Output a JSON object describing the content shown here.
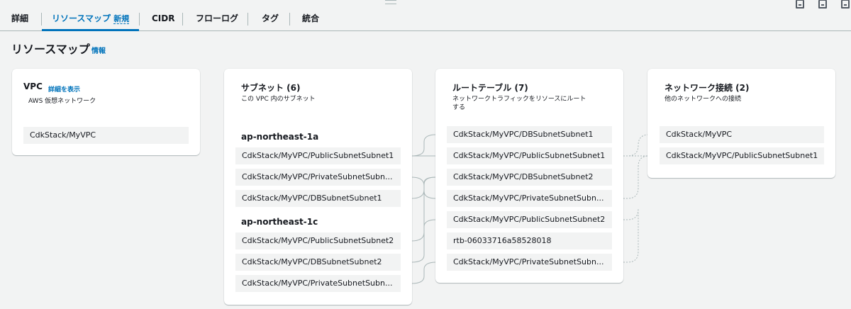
{
  "tabs": [
    {
      "label": "詳細"
    },
    {
      "label": "リソースマップ",
      "badge": "新規"
    },
    {
      "label": "CIDR"
    },
    {
      "label": "フローログ"
    },
    {
      "label": "タグ"
    },
    {
      "label": "統合"
    }
  ],
  "page": {
    "title": "リソースマップ",
    "info_link": "情報"
  },
  "vpc_card": {
    "title": "VPC",
    "detail_link": "詳細を表示",
    "description": "AWS 仮想ネットワーク",
    "items": [
      "CdkStack/MyVPC"
    ]
  },
  "subnets_card": {
    "title": "サブネット (6)",
    "description": "この VPC 内のサブネット",
    "groups": [
      {
        "az": "ap-northeast-1a",
        "items": [
          "CdkStack/MyVPC/PublicSubnetSubnet1",
          "CdkStack/MyVPC/PrivateSubnetSubn...",
          "CdkStack/MyVPC/DBSubnetSubnet1"
        ]
      },
      {
        "az": "ap-northeast-1c",
        "items": [
          "CdkStack/MyVPC/PublicSubnetSubnet2",
          "CdkStack/MyVPC/DBSubnetSubnet2",
          "CdkStack/MyVPC/PrivateSubnetSubn..."
        ]
      }
    ]
  },
  "route_tables_card": {
    "title": "ルートテーブル (7)",
    "description_line1": "ネットワークトラフィックをリソースにルート",
    "description_line2": "する",
    "items": [
      "CdkStack/MyVPC/DBSubnetSubnet1",
      "CdkStack/MyVPC/PublicSubnetSubnet1",
      "CdkStack/MyVPC/DBSubnetSubnet2",
      "CdkStack/MyVPC/PrivateSubnetSubn...",
      "CdkStack/MyVPC/PublicSubnetSubnet2",
      "rtb-06033716a58528018",
      "CdkStack/MyVPC/PrivateSubnetSubn..."
    ]
  },
  "network_card": {
    "title": "ネットワーク接続 (2)",
    "description": "他のネットワークへの接続",
    "items": [
      "CdkStack/MyVPC",
      "CdkStack/MyVPC/PublicSubnetSubnet1"
    ]
  },
  "colors": {
    "accent": "#0073bb",
    "background": "#f2f3f3",
    "chip": "#f2f3f3",
    "connector": "#aab7b8"
  },
  "icons": [
    "drag-handle-icon",
    "window-icon"
  ]
}
